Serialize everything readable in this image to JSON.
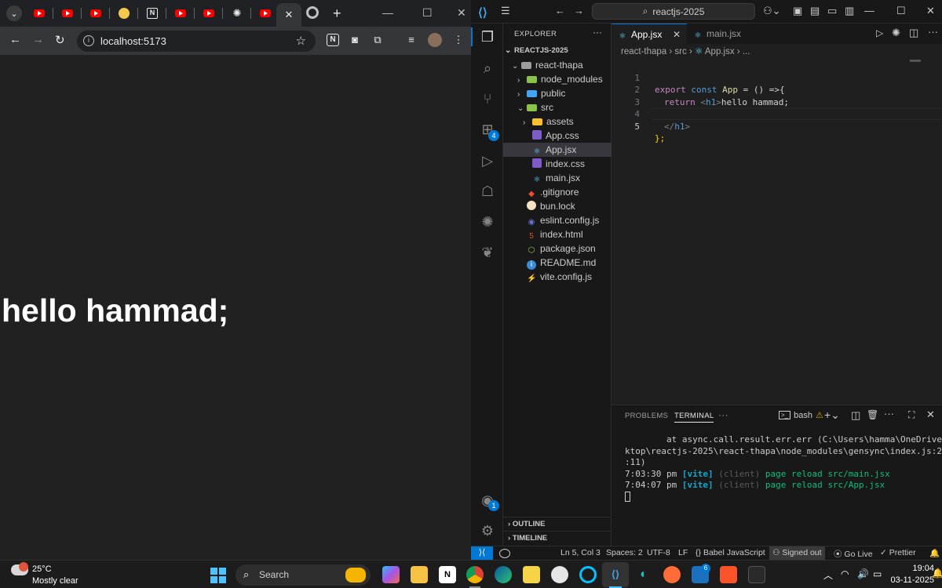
{
  "browser": {
    "tabs": [
      {
        "icon": "youtube-icon"
      },
      {
        "icon": "youtube-icon"
      },
      {
        "icon": "youtube-icon"
      },
      {
        "icon": "extension-icon"
      },
      {
        "icon": "notion-icon"
      },
      {
        "icon": "youtube-icon"
      },
      {
        "icon": "youtube-icon"
      },
      {
        "icon": "chatgpt-icon"
      },
      {
        "icon": "youtube-icon"
      }
    ],
    "active_tab_close": "✕",
    "new_tab": "+",
    "url": "localhost:5173",
    "page": {
      "heading": "hello hammad;"
    }
  },
  "vscode": {
    "search": "reactjs-2025",
    "explorer": {
      "title": "EXPLORER",
      "root": "REACTJS-2025",
      "items": [
        {
          "label": "react-thapa",
          "depth": 1,
          "type": "folder-open"
        },
        {
          "label": "node_modules",
          "depth": 2,
          "type": "folder"
        },
        {
          "label": "public",
          "depth": 2,
          "type": "folder"
        },
        {
          "label": "src",
          "depth": 2,
          "type": "folder-open"
        },
        {
          "label": "assets",
          "depth": 3,
          "type": "folder"
        },
        {
          "label": "App.css",
          "depth": 3,
          "type": "css"
        },
        {
          "label": "App.jsx",
          "depth": 3,
          "type": "react",
          "selected": true
        },
        {
          "label": "index.css",
          "depth": 3,
          "type": "css"
        },
        {
          "label": "main.jsx",
          "depth": 3,
          "type": "react"
        },
        {
          "label": ".gitignore",
          "depth": 2,
          "type": "git"
        },
        {
          "label": "bun.lock",
          "depth": 2,
          "type": "bun"
        },
        {
          "label": "eslint.config.js",
          "depth": 2,
          "type": "eslint"
        },
        {
          "label": "index.html",
          "depth": 2,
          "type": "html"
        },
        {
          "label": "package.json",
          "depth": 2,
          "type": "node"
        },
        {
          "label": "README.md",
          "depth": 2,
          "type": "info"
        },
        {
          "label": "vite.config.js",
          "depth": 2,
          "type": "vite"
        }
      ],
      "outline": "OUTLINE",
      "timeline": "TIMELINE"
    },
    "extensions_badge": "4",
    "accounts_badge": "1",
    "editor_tabs": [
      {
        "label": "App.jsx",
        "active": true
      },
      {
        "label": "main.jsx",
        "active": false
      }
    ],
    "breadcrumbs": [
      "react-thapa",
      "src",
      "App.jsx",
      "..."
    ],
    "code": {
      "line_numbers": [
        "1",
        "2",
        "3",
        "4",
        "5"
      ],
      "l1": {
        "kw": "export",
        "kw2": "const",
        "fn": "App",
        "rest": " = () =>{"
      },
      "l2": {
        "kw": "return",
        "open": "<",
        "tag": "h1",
        "close": ">",
        "text": "hello hammad;"
      },
      "l4": {
        "open": "</",
        "tag": "h1",
        "close": ">"
      },
      "l5": {
        "text": "};"
      }
    },
    "panel": {
      "tabs": [
        "PROBLEMS",
        "TERMINAL",
        "···"
      ],
      "shell": "bash",
      "lines": [
        "        at async.call.result.err.err (C:\\Users\\hamma\\OneDrive\\Des",
        "ktop\\reactjs-2025\\react-thapa\\node_modules\\gensync\\index.js:223",
        ":11)"
      ],
      "log": [
        {
          "time": "7:03:30 pm",
          "tag": "[vite]",
          "src": "(client)",
          "msg": "page reload src/main.jsx"
        },
        {
          "time": "7:04:07 pm",
          "tag": "[vite]",
          "src": "(client)",
          "msg": "page reload src/App.jsx"
        }
      ]
    },
    "status": {
      "position": "Ln 5, Col 3",
      "spaces": "Spaces: 2",
      "encoding": "UTF-8",
      "eol": "LF",
      "language": "Babel JavaScript",
      "account": "Signed out",
      "golive": "Go Live",
      "prettier": "Prettier"
    }
  },
  "taskbar": {
    "weather": {
      "temp": "25°C",
      "condition": "Mostly clear"
    },
    "search": "Search",
    "badge": "6",
    "time": "19:04",
    "date": "03-11-2025"
  }
}
